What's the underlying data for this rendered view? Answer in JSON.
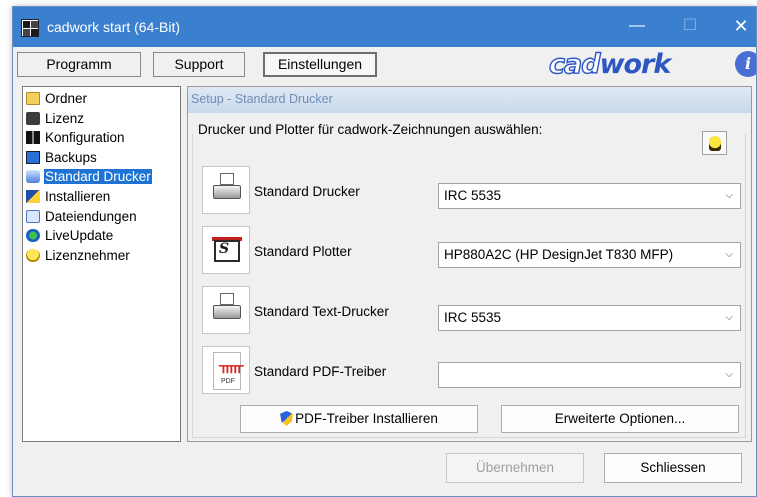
{
  "window": {
    "title": "cadwork start (64-Bit)",
    "controls": {
      "minimize": "—",
      "maximize": "☐",
      "close": "✕"
    }
  },
  "tabs": [
    {
      "label": "Programm",
      "active": false
    },
    {
      "label": "Support",
      "active": false
    },
    {
      "label": "Einstellungen",
      "active": true
    }
  ],
  "logo": {
    "part1": "cad",
    "part2": "work"
  },
  "info_button": "i",
  "sidebar": {
    "items": [
      {
        "label": "Ordner",
        "icon": "folder-icon",
        "selected": false
      },
      {
        "label": "Lizenz",
        "icon": "license-icon",
        "selected": false
      },
      {
        "label": "Konfiguration",
        "icon": "configuration-icon",
        "selected": false
      },
      {
        "label": "Backups",
        "icon": "backups-icon",
        "selected": false
      },
      {
        "label": "Standard Drucker",
        "icon": "printer-icon",
        "selected": true
      },
      {
        "label": "Installieren",
        "icon": "install-icon",
        "selected": false
      },
      {
        "label": "Dateiendungen",
        "icon": "file-extensions-icon",
        "selected": false
      },
      {
        "label": "LiveUpdate",
        "icon": "liveupdate-icon",
        "selected": false
      },
      {
        "label": "Lizenznehmer",
        "icon": "lightbulb-icon",
        "selected": false
      }
    ]
  },
  "main": {
    "header": "Setup - Standard Drucker",
    "group_title": "Drucker und Plotter für cadwork-Zeichnungen auswählen:",
    "rows": [
      {
        "label": "Standard Drucker",
        "value": "IRC 5535",
        "icon": "printer-icon"
      },
      {
        "label": "Standard Plotter",
        "value": "HP880A2C (HP DesignJet T830 MFP)",
        "icon": "plotter-icon"
      },
      {
        "label": "Standard Text-Drucker",
        "value": "IRC 5535",
        "icon": "printer-icon"
      },
      {
        "label": "Standard PDF-Treiber",
        "value": "",
        "icon": "pdf-icon"
      }
    ],
    "buttons": {
      "pdf_install": "PDF-Treiber Installieren",
      "advanced": "Erweiterte Optionen..."
    }
  },
  "footer": {
    "apply": "Übernehmen",
    "close": "Schliessen"
  },
  "colors": {
    "titlebar": "#3b7fcf",
    "selection": "#1f73d2",
    "logo_blue": "#2d56c2"
  }
}
